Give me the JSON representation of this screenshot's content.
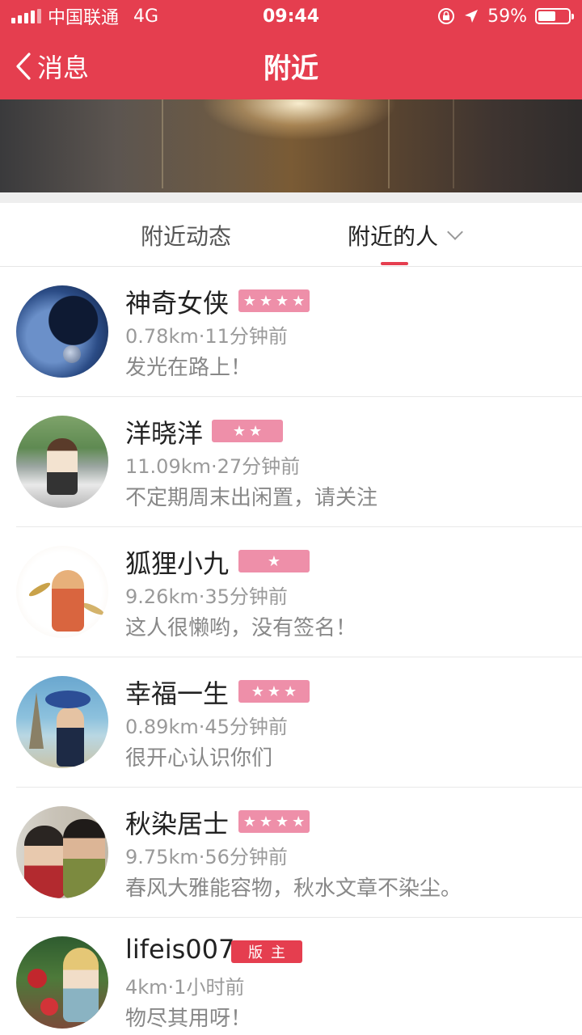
{
  "status_bar": {
    "carrier": "中国联通",
    "network": "4G",
    "time": "09:44",
    "battery_percent": "59%",
    "battery_level": 0.59,
    "icons": [
      "signal-icon",
      "rotation-lock-icon",
      "location-arrow-icon",
      "battery-icon"
    ]
  },
  "nav": {
    "back_label": "消息",
    "title": "附近"
  },
  "tabs": {
    "feed_label": "附近动态",
    "people_label": "附近的人",
    "active": "people"
  },
  "colors": {
    "brand": "#e53e4f",
    "badge_pink": "#ee8fa9",
    "meta_gray": "#9a9a9a"
  },
  "people": [
    {
      "name": "神奇女侠",
      "badge": "★★★★",
      "meta": "0.78km·11分钟前",
      "signature": "发光在路上！"
    },
    {
      "name": "洋晓洋",
      "badge": "★★",
      "meta": "11.09km·27分钟前",
      "signature": "不定期周末出闲置，请关注"
    },
    {
      "name": "狐狸小九",
      "badge": "★",
      "meta": "9.26km·35分钟前",
      "signature": "这人很懒哟，没有签名！"
    },
    {
      "name": "幸福一生",
      "badge": "★★★",
      "meta": "0.89km·45分钟前",
      "signature": "很开心认识你们"
    },
    {
      "name": "秋染居士",
      "badge": "★★★★",
      "meta": "9.75km·56分钟前",
      "signature": "春风大雅能容物，秋水文章不染尘。"
    },
    {
      "name": "lifeis007",
      "badge": "版主",
      "meta": "4km·1小时前",
      "signature": "物尽其用呀！"
    }
  ]
}
